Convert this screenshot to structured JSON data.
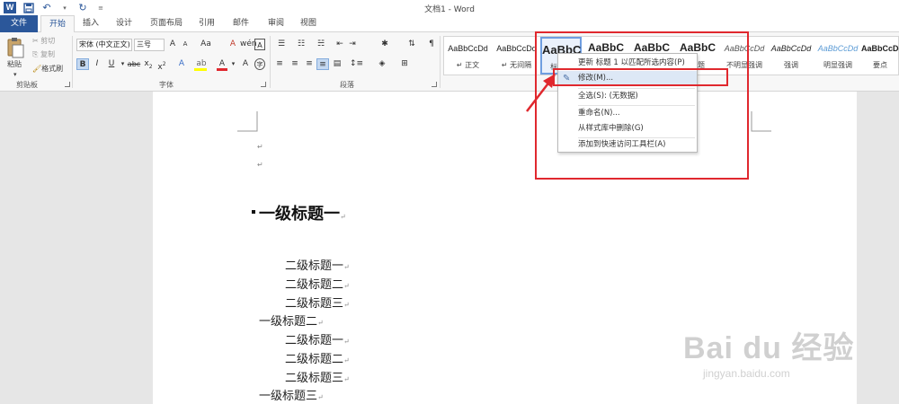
{
  "window": {
    "title": "文档1 - Word"
  },
  "tabs": [
    {
      "label": "文件"
    },
    {
      "label": "开始"
    },
    {
      "label": "插入"
    },
    {
      "label": "设计"
    },
    {
      "label": "页面布局"
    },
    {
      "label": "引用"
    },
    {
      "label": "邮件"
    },
    {
      "label": "审阅"
    },
    {
      "label": "视图"
    }
  ],
  "active_tab": "开始",
  "clipboard": {
    "paste": "粘贴",
    "cut": "剪切",
    "copy": "复制",
    "format_painter": "格式刷",
    "group_label": "剪贴板"
  },
  "font": {
    "name": "宋体 (中文正文)",
    "size": "三号",
    "group_label": "字体",
    "grow": "A",
    "shrink": "A",
    "case": "Aa",
    "clear": "A",
    "bold": "B",
    "italic": "I",
    "underline": "U",
    "strike": "abc",
    "subscript": "x",
    "superscript": "x",
    "color": "A"
  },
  "paragraph": {
    "group_label": "段落"
  },
  "styles": [
    {
      "preview": "AaBbCcDd",
      "name": "↵ 正文"
    },
    {
      "preview": "AaBbCcDd",
      "name": "↵ 无间隔"
    },
    {
      "preview": "AaBbC",
      "name": "标题 1"
    },
    {
      "preview": "AaBbC",
      "name": ""
    },
    {
      "preview": "AaBbC",
      "name": ""
    },
    {
      "preview": "AaBbC",
      "name": "标题"
    },
    {
      "preview": "AaBbCcDd",
      "name": "不明显强调"
    },
    {
      "preview": "AaBbCcDd",
      "name": "强调"
    },
    {
      "preview": "AaBbCcDd",
      "name": "明显强调"
    },
    {
      "preview": "AaBbCcDd",
      "name": "要点"
    }
  ],
  "context_menu": {
    "items": [
      {
        "label": "更新 标题 1 以匹配所选内容(P)"
      },
      {
        "label": "修改(M)..."
      },
      {
        "label": "全选(S): (无数据)"
      },
      {
        "label": "重命名(N)..."
      },
      {
        "label": "从样式库中删除(G)"
      },
      {
        "label": "添加到快速访问工具栏(A)"
      }
    ]
  },
  "document": {
    "heading": "一级标题一",
    "lines": [
      {
        "text": "二级标题一"
      },
      {
        "text": "二级标题二"
      },
      {
        "text": "二级标题三"
      },
      {
        "text": "一级标题二"
      },
      {
        "text": "二级标题一"
      },
      {
        "text": "二级标题二"
      },
      {
        "text": "二级标题三"
      },
      {
        "text": "一级标题三"
      }
    ],
    "para_mark": "↵"
  },
  "watermark": {
    "brand": "Bai du 经验",
    "url": "jingyan.baidu.com"
  },
  "colors": {
    "accent": "#2b579a",
    "annotation": "#e0282e",
    "highlight_yellow": "#ffff00",
    "font_red": "#e0282e"
  }
}
